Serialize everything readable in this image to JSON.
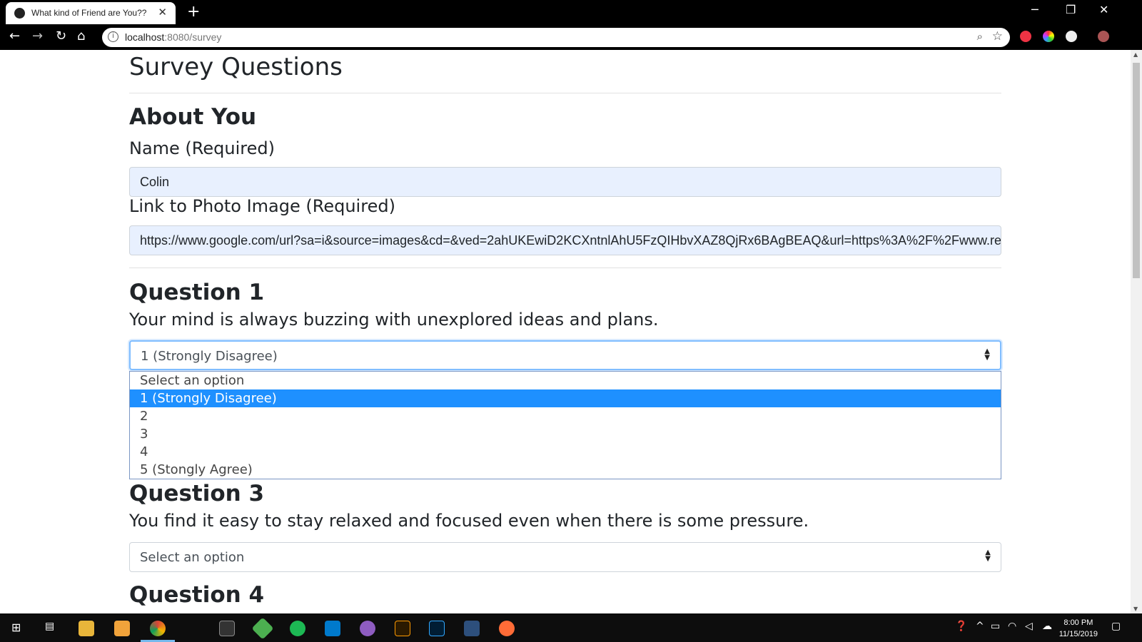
{
  "browser": {
    "tab_title": "What kind of Friend are You??",
    "tab_close": "✕",
    "new_tab": "+",
    "url_host": "localhost",
    "url_path": ":8080/survey",
    "win_min": "─",
    "win_restore": "❐",
    "win_close": "✕"
  },
  "page": {
    "title": "Survey Questions",
    "about_heading": "About You",
    "name_label": "Name (Required)",
    "name_value": "Colin",
    "photo_label": "Link to Photo Image (Required)",
    "photo_value": "https://www.google.com/url?sa=i&source=images&cd=&ved=2ahUKEwiD2KCXntnlAhU5FzQIHbvXAZ8QjRx6BAgBEAQ&url=https%3A%2F%2Fwww.redbu",
    "q1": {
      "heading": "Question 1",
      "text": "Your mind is always buzzing with unexplored ideas and plans.",
      "selected": "1 (Strongly Disagree)",
      "options": [
        "Select an option",
        "1 (Strongly Disagree)",
        "2",
        "3",
        "4",
        "5 (Stongly Agree)"
      ]
    },
    "q3": {
      "heading": "Question 3",
      "text": "You find it easy to stay relaxed and focused even when there is some pressure.",
      "selected": "Select an option"
    },
    "q4": {
      "heading": "Question 4"
    }
  },
  "taskbar": {
    "time": "8:00 PM",
    "date": "11/15/2019"
  },
  "colors": {
    "accent": "#1e90ff",
    "autofill_bg": "#e8f0fe",
    "focus_border": "#80bdff"
  }
}
